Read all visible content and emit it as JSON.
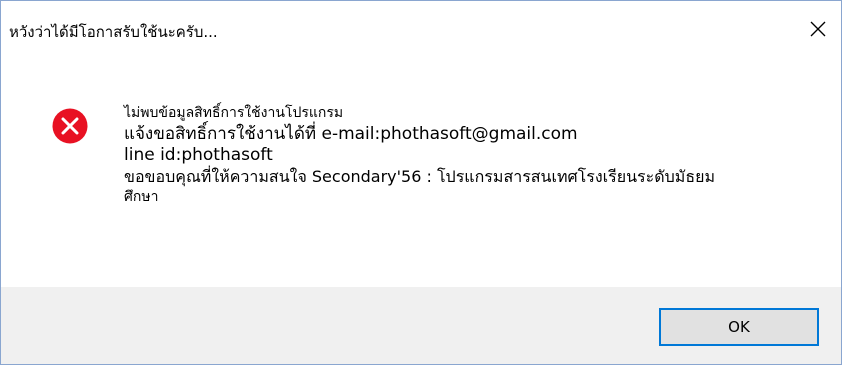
{
  "window": {
    "title": "หวังว่าได้มีโอกาสรับใช้นะครับ..."
  },
  "message": {
    "icon": "error-icon",
    "lines": [
      "ไม่พบข้อมูลสิทธิ์การใช้งานโปรแกรม",
      "แจ้งขอสิทธิ์การใช้งานได้ที่  e-mail:phothasoft@gmail.com",
      "line id:phothasoft",
      "ขอขอบคุณที่ให้ความสนใจ Secondary'56 : โปรแกรมสารสนเทศโรงเรียนระดับมัธยม",
      "ศึกษา"
    ]
  },
  "buttons": {
    "ok_label": "OK"
  },
  "colors": {
    "error_red": "#e81123",
    "accent_blue": "#0078d7",
    "footer_bg": "#f0f0f0"
  }
}
